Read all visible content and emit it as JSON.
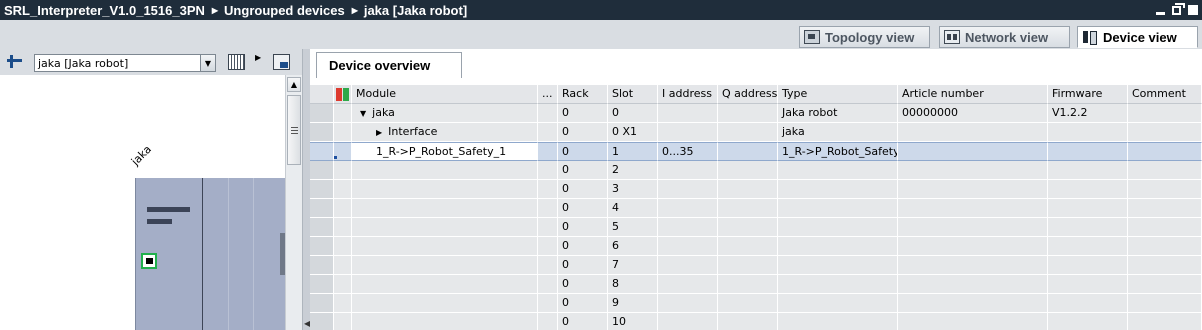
{
  "titlebar": {
    "breadcrumbs": [
      "SRL_Interpreter_V1.0_1516_3PN",
      "Ungrouped devices",
      "jaka [Jaka robot]"
    ]
  },
  "view_tabs": [
    {
      "label": "Topology view",
      "icon": "topology-icon",
      "active": false
    },
    {
      "label": "Network view",
      "icon": "network-icon",
      "active": false
    },
    {
      "label": "Device view",
      "icon": "device-icon",
      "active": true
    }
  ],
  "left_toolbar": {
    "device_select_value": "jaka [Jaka robot]"
  },
  "canvas": {
    "device_label": "jaka"
  },
  "overview": {
    "tab_label": "Device overview",
    "columns": [
      "Module",
      "...",
      "Rack",
      "Slot",
      "I address",
      "Q address",
      "Type",
      "Article number",
      "Firmware",
      "Comment"
    ],
    "rows": [
      {
        "module": "jaka",
        "expand": "open",
        "dots": "",
        "rack": "0",
        "slot": "0",
        "i_address": "",
        "q_address": "",
        "type": "Jaka robot",
        "article": "00000000",
        "firmware": "V1.2.2",
        "comment": ""
      },
      {
        "module": "Interface",
        "expand": "closed",
        "dots": "",
        "rack": "0",
        "slot": "0 X1",
        "i_address": "",
        "q_address": "",
        "type": "jaka",
        "article": "",
        "firmware": "",
        "comment": ""
      },
      {
        "module": "1_R->P_Robot_Safety_1",
        "expand": "",
        "dots": "",
        "rack": "0",
        "slot": "1",
        "i_address": "0...35",
        "q_address": "",
        "type": "1_R->P_Robot_Safety",
        "article": "",
        "firmware": "",
        "comment": "",
        "selected": true
      },
      {
        "module": "",
        "expand": "",
        "dots": "",
        "rack": "0",
        "slot": "2",
        "i_address": "",
        "q_address": "",
        "type": "",
        "article": "",
        "firmware": "",
        "comment": ""
      },
      {
        "module": "",
        "expand": "",
        "dots": "",
        "rack": "0",
        "slot": "3",
        "i_address": "",
        "q_address": "",
        "type": "",
        "article": "",
        "firmware": "",
        "comment": ""
      },
      {
        "module": "",
        "expand": "",
        "dots": "",
        "rack": "0",
        "slot": "4",
        "i_address": "",
        "q_address": "",
        "type": "",
        "article": "",
        "firmware": "",
        "comment": ""
      },
      {
        "module": "",
        "expand": "",
        "dots": "",
        "rack": "0",
        "slot": "5",
        "i_address": "",
        "q_address": "",
        "type": "",
        "article": "",
        "firmware": "",
        "comment": ""
      },
      {
        "module": "",
        "expand": "",
        "dots": "",
        "rack": "0",
        "slot": "6",
        "i_address": "",
        "q_address": "",
        "type": "",
        "article": "",
        "firmware": "",
        "comment": ""
      },
      {
        "module": "",
        "expand": "",
        "dots": "",
        "rack": "0",
        "slot": "7",
        "i_address": "",
        "q_address": "",
        "type": "",
        "article": "",
        "firmware": "",
        "comment": ""
      },
      {
        "module": "",
        "expand": "",
        "dots": "",
        "rack": "0",
        "slot": "8",
        "i_address": "",
        "q_address": "",
        "type": "",
        "article": "",
        "firmware": "",
        "comment": ""
      },
      {
        "module": "",
        "expand": "",
        "dots": "",
        "rack": "0",
        "slot": "9",
        "i_address": "",
        "q_address": "",
        "type": "",
        "article": "",
        "firmware": "",
        "comment": ""
      },
      {
        "module": "",
        "expand": "",
        "dots": "",
        "rack": "0",
        "slot": "10",
        "i_address": "",
        "q_address": "",
        "type": "",
        "article": "",
        "firmware": "",
        "comment": ""
      }
    ]
  }
}
